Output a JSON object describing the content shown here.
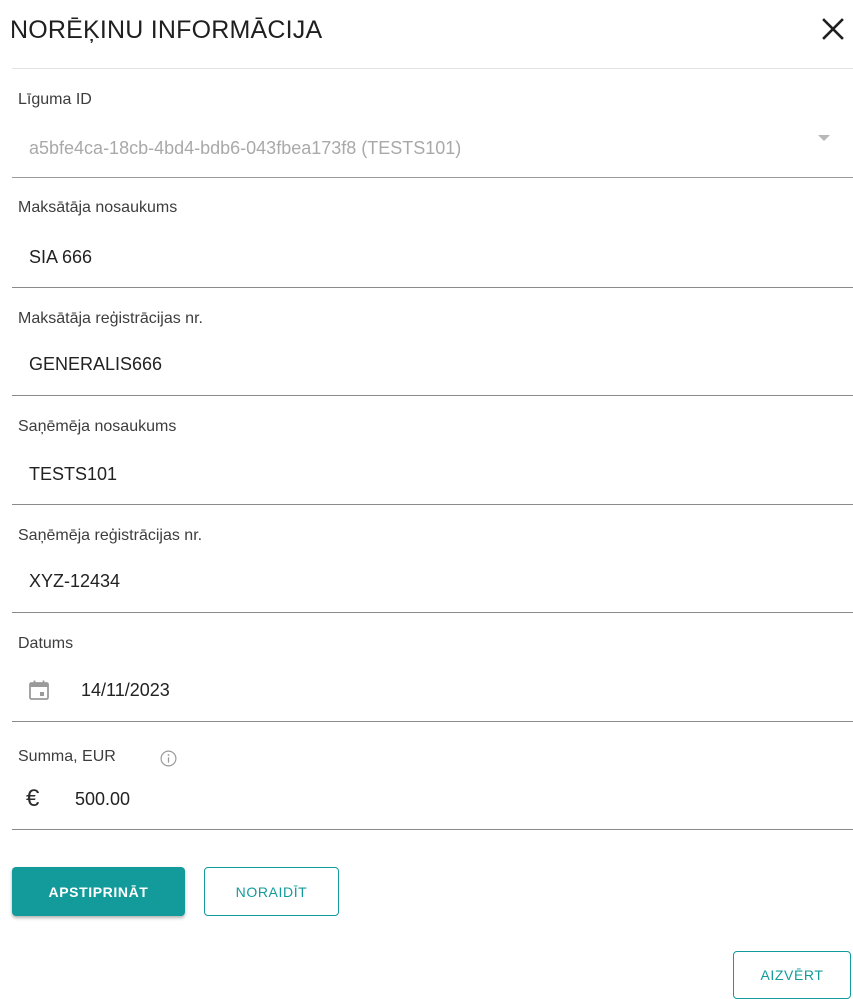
{
  "dialog": {
    "title": "NORĒĶINU INFORMĀCIJA"
  },
  "fields": {
    "contract": {
      "label": "Līguma ID",
      "value": "a5bfe4ca-18cb-4bd4-bdb6-043fbea173f8 (TESTS101)"
    },
    "payer_name": {
      "label": "Maksātāja nosaukums",
      "value": "SIA 666"
    },
    "payer_reg": {
      "label": "Maksātāja reģistrācijas nr.",
      "value": "GENERALIS666"
    },
    "receiver_name": {
      "label": "Saņēmēja nosaukums",
      "value": "TESTS101"
    },
    "receiver_reg": {
      "label": "Saņēmēja reģistrācijas nr.",
      "value": "XYZ-12434"
    },
    "date": {
      "label": "Datums",
      "value": "14/11/2023"
    },
    "amount": {
      "label": "Summa, EUR",
      "value": "500.00",
      "currency_symbol": "€"
    }
  },
  "actions": {
    "approve_label": "APSTIPRINĀT",
    "reject_label": "NORAIDĪT",
    "close_label": "AIZVĒRT"
  },
  "icons": {
    "close": "close-icon",
    "dropdown": "chevron-down-icon",
    "calendar": "calendar-icon",
    "info": "info-icon",
    "currency": "euro-icon"
  },
  "colors": {
    "accent": "#139b9b",
    "disabled_text": "#a9a9a9",
    "underline": "#8a8a8a"
  }
}
